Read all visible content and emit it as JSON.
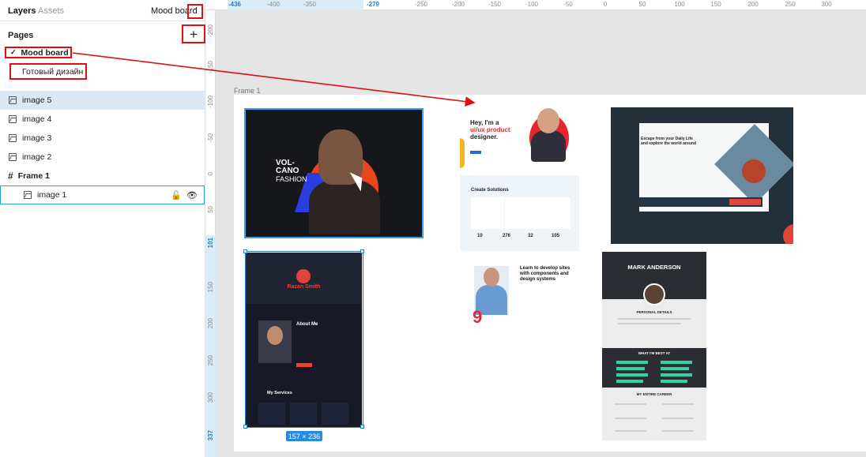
{
  "left_panel": {
    "tabs": [
      {
        "label": "Layers",
        "active": true
      },
      {
        "label": "Assets",
        "active": false
      }
    ],
    "current_page_selector": "Mood board",
    "chevron_icon": "chevron-up-icon",
    "pages_title": "Pages",
    "add_page_icon": "plus-icon",
    "pages": [
      {
        "label": "Mood board",
        "current": true
      },
      {
        "label": "Готовый дизайн",
        "current": false
      }
    ],
    "layers": [
      {
        "label": "image 5",
        "type": "image",
        "selected": true
      },
      {
        "label": "image 4",
        "type": "image"
      },
      {
        "label": "image 3",
        "type": "image"
      },
      {
        "label": "image 2",
        "type": "image"
      },
      {
        "label": "Frame 1",
        "type": "frame"
      },
      {
        "label": "image 1",
        "type": "image",
        "hovered": true,
        "actions": [
          "unlock-icon",
          "eye-icon"
        ]
      }
    ]
  },
  "rulers": {
    "top": {
      "highlight_labels": [
        "-436",
        "-279"
      ],
      "labels": [
        "-400",
        "-350",
        "-250",
        "-200",
        "-150",
        "-100",
        "-50",
        "0",
        "50",
        "100",
        "150",
        "200",
        "250",
        "300"
      ]
    },
    "left": {
      "highlight_labels": [
        "101",
        "337"
      ],
      "labels": [
        "-200",
        "-150",
        "-100",
        "-50",
        "0",
        "50",
        "150",
        "200",
        "250",
        "300"
      ]
    }
  },
  "canvas": {
    "frame_label": "Frame 1",
    "selection_size": "157 × 236",
    "thumbnails": {
      "image5": {
        "title_line1": "VOL-",
        "title_line2": "CANO",
        "title_line3": "FASHION"
      },
      "image4": {
        "headline_line1": "Hey, I'm a",
        "headline_line2": "ui/ux product",
        "headline_line3": "designer.",
        "section_title": "Create Solutions",
        "stats": [
          "10",
          "276",
          "32",
          "105"
        ]
      },
      "image3": {
        "headline_line1": "Escape from your Daily Life",
        "headline_line2": "and explore the world around"
      },
      "image2": {
        "name": "Razan Smith",
        "about_title": "About Me",
        "services_title": "My Services"
      },
      "image1": {
        "headline_line1": "Learn to develop sites",
        "headline_line2": "with components and",
        "headline_line3": "design systems",
        "badge": "9"
      },
      "resume": {
        "name": "MARK ANDERSON",
        "section_details": "PERSONAL DETAILS",
        "section_skills": "WHAT I'M BEST AT",
        "section_career": "MY ENTIRE CAREER"
      }
    }
  },
  "colors": {
    "annotation_red": "#e01010",
    "selection_blue": "#2a7fc0",
    "layer_selected_bg": "#dbe9f6"
  }
}
